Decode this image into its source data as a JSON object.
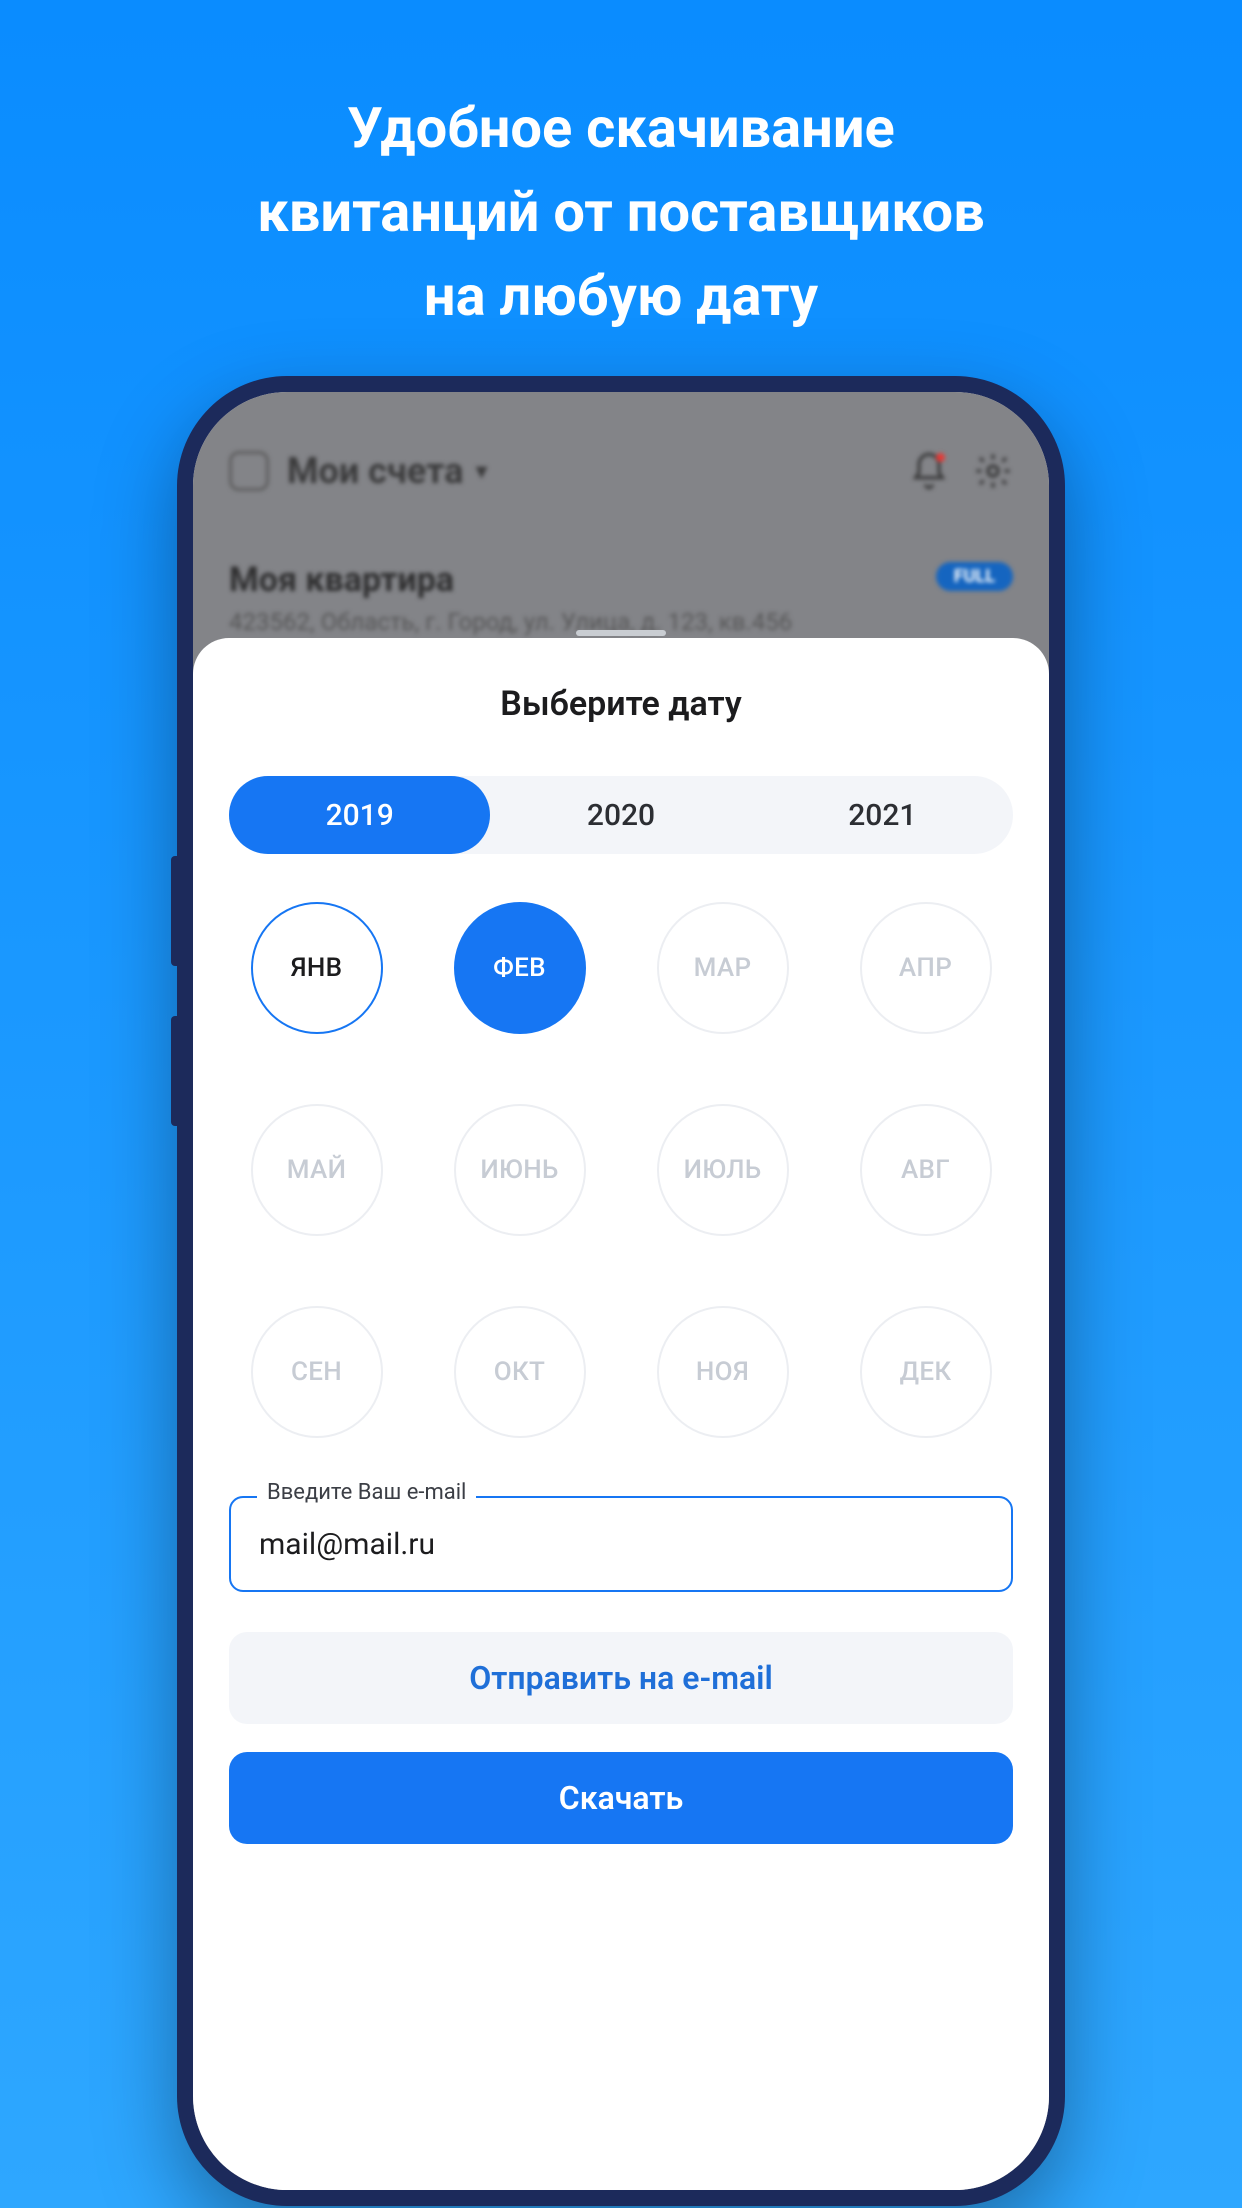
{
  "promo": {
    "heading_line1": "Удобное скачивание",
    "heading_line2": "квитанций от поставщиков",
    "heading_line3": "на любую дату"
  },
  "background": {
    "accounts_title": "Мои счета",
    "card_title": "Моя квартира",
    "card_badge": "FULL",
    "card_address": "423562, Область, г. Город, ул. Улица, д. 123, кв.456"
  },
  "sheet": {
    "title": "Выберите дату",
    "years": [
      {
        "label": "2019",
        "active": true
      },
      {
        "label": "2020",
        "active": false
      },
      {
        "label": "2021",
        "active": false
      }
    ],
    "months": [
      {
        "label": "ЯНВ",
        "state": "outlined"
      },
      {
        "label": "ФЕВ",
        "state": "selected"
      },
      {
        "label": "МАР",
        "state": "disabled"
      },
      {
        "label": "АПР",
        "state": "disabled"
      },
      {
        "label": "МАЙ",
        "state": "disabled"
      },
      {
        "label": "ИЮНЬ",
        "state": "disabled"
      },
      {
        "label": "ИЮЛЬ",
        "state": "disabled"
      },
      {
        "label": "АВГ",
        "state": "disabled"
      },
      {
        "label": "СЕН",
        "state": "disabled"
      },
      {
        "label": "ОКТ",
        "state": "disabled"
      },
      {
        "label": "НОЯ",
        "state": "disabled"
      },
      {
        "label": "ДЕК",
        "state": "disabled"
      }
    ],
    "email_label": "Введите Ваш e-mail",
    "email_value": "mail@mail.ru",
    "send_btn": "Отправить на e-mail",
    "download_btn": "Скачать"
  }
}
